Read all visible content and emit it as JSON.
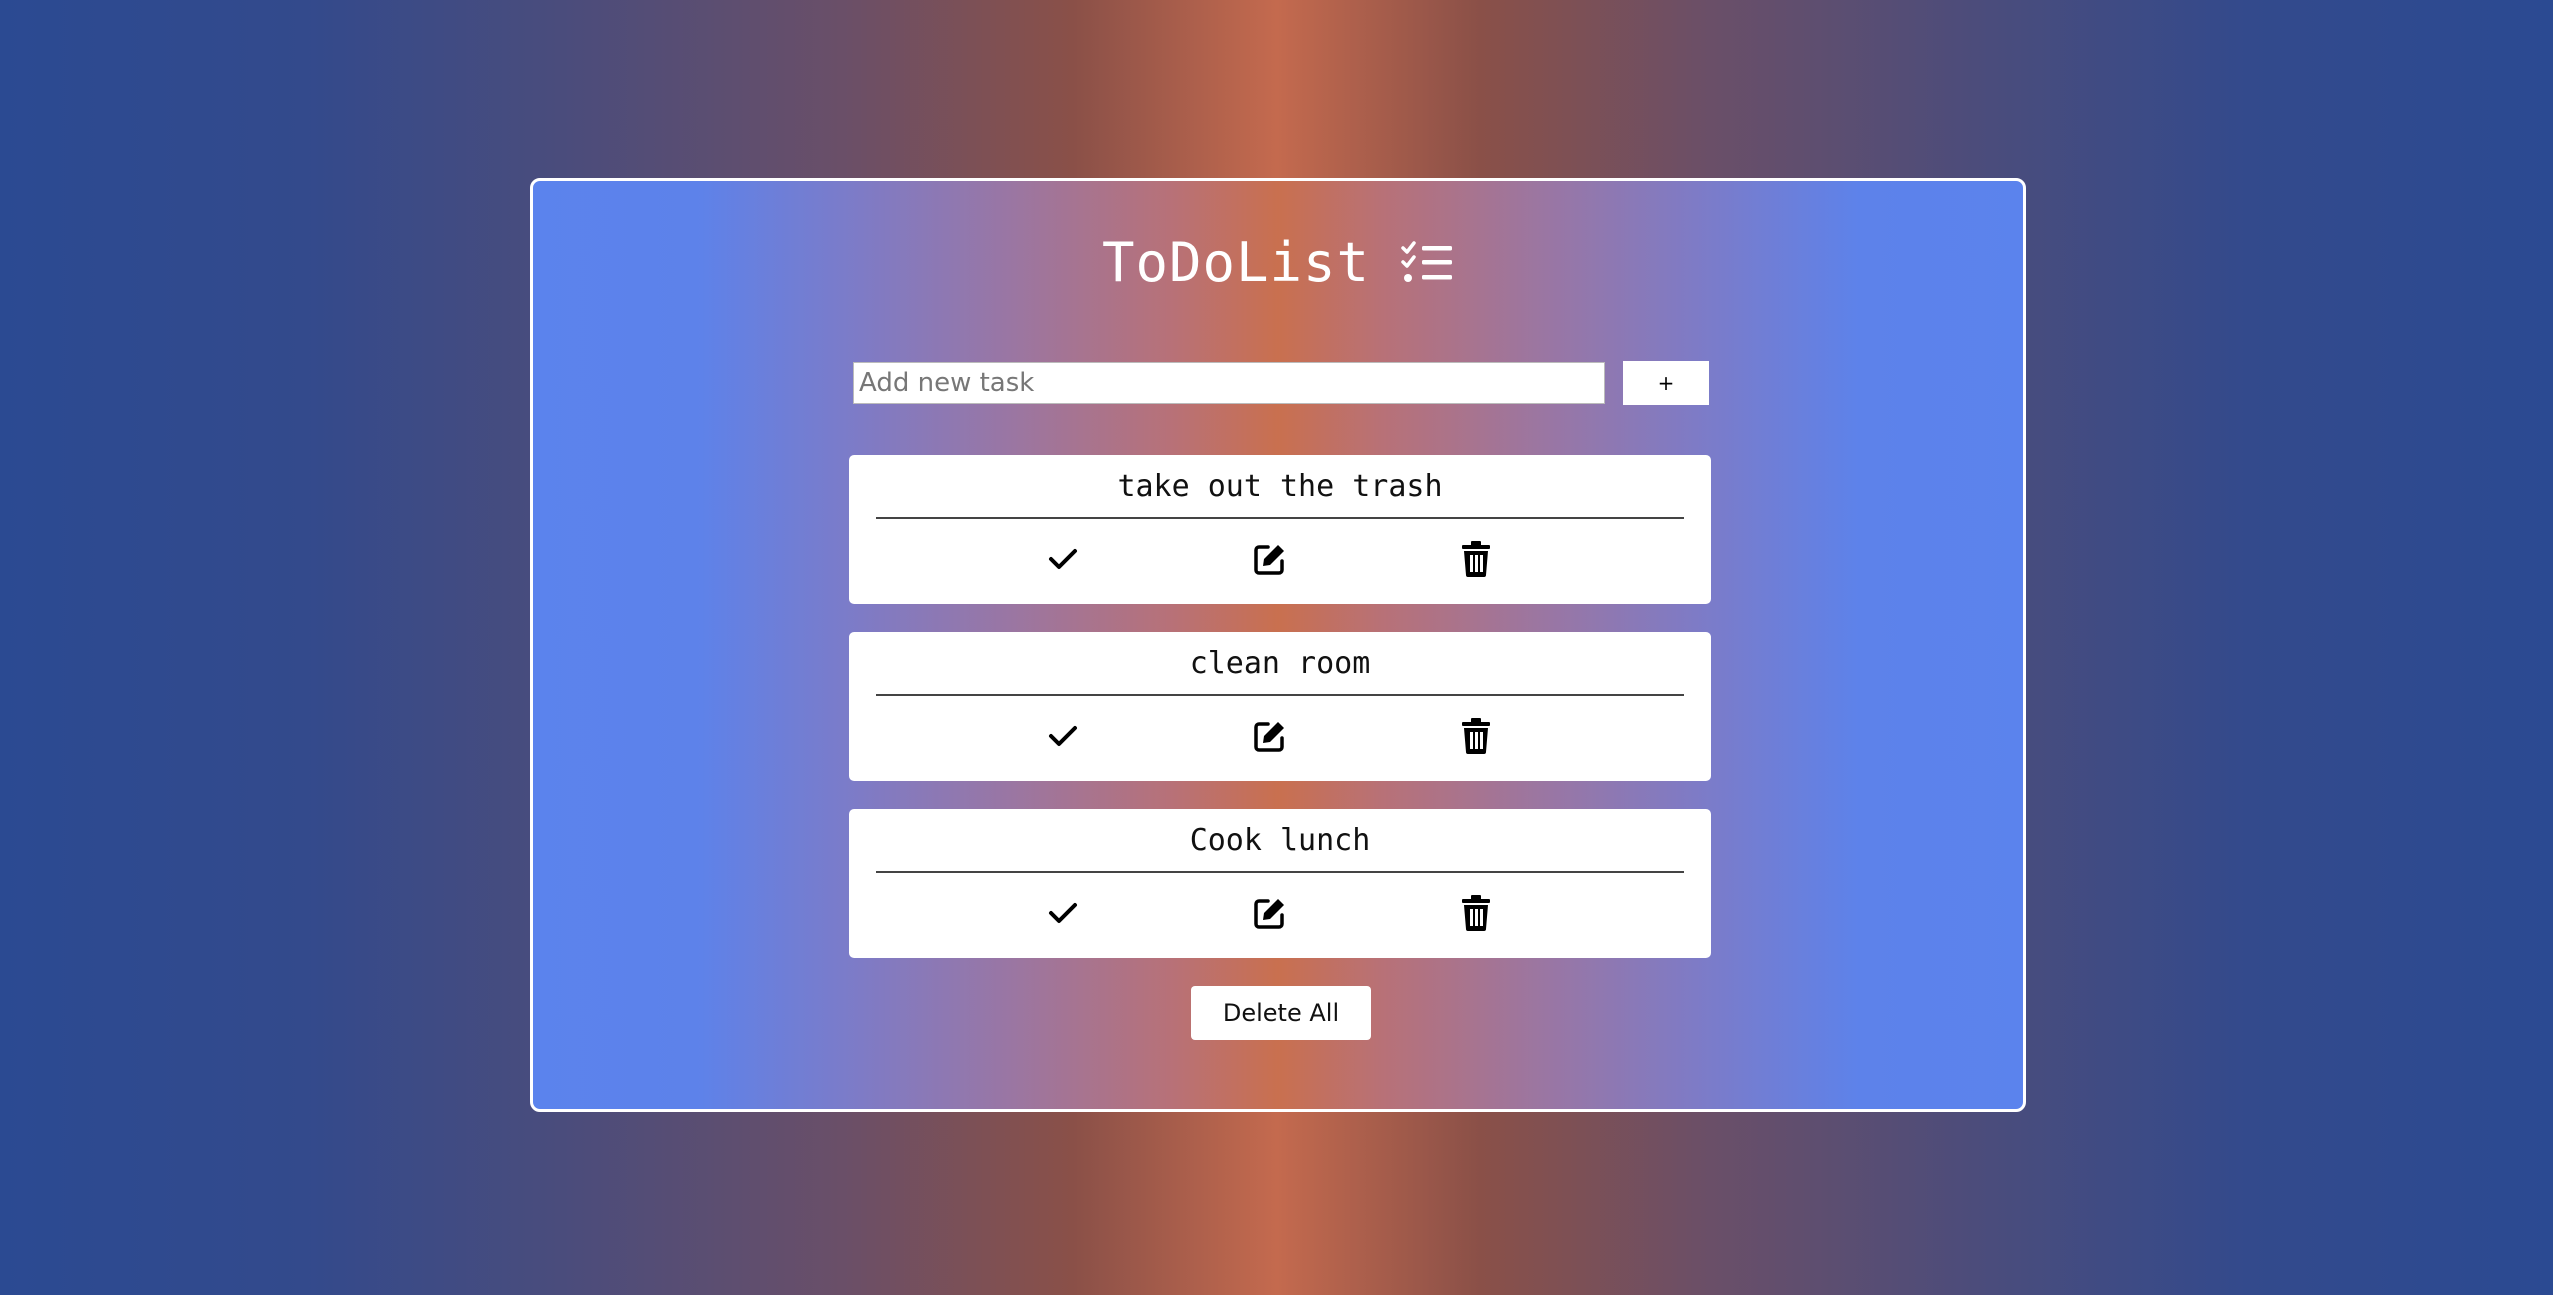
{
  "app": {
    "title": "ToDoList",
    "title_icon": "checklist-icon"
  },
  "new_task": {
    "placeholder": "Add new task",
    "value": "",
    "add_label": "+"
  },
  "tasks": [
    {
      "text": "take out the trash"
    },
    {
      "text": "clean room"
    },
    {
      "text": "Cook lunch"
    }
  ],
  "task_actions": {
    "complete_icon": "check-icon",
    "edit_icon": "edit-icon",
    "delete_icon": "trash-icon"
  },
  "footer": {
    "delete_all_label": "Delete All"
  },
  "colors": {
    "page_edge": "#2b4a92",
    "page_center": "#c46a4e",
    "card_edge": "#5b83ed",
    "card_center": "#c9704f",
    "surface": "#ffffff"
  }
}
